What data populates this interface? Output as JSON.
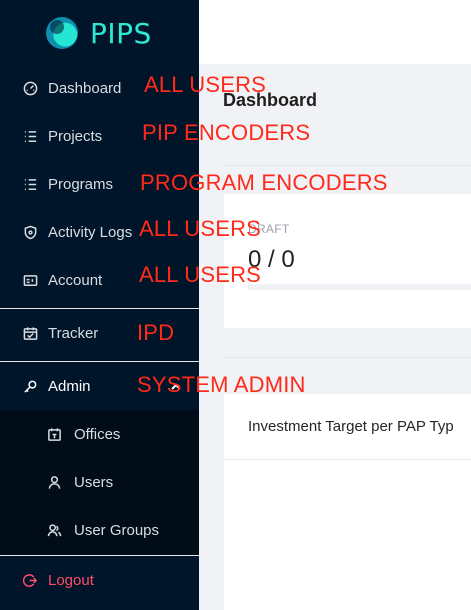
{
  "brand": {
    "name": "PIPS"
  },
  "sidebar": {
    "items": [
      {
        "label": "Dashboard",
        "icon": "dashboard-icon"
      },
      {
        "label": "Projects",
        "icon": "list-icon"
      },
      {
        "label": "Programs",
        "icon": "list-icon"
      },
      {
        "label": "Activity Logs",
        "icon": "shield-icon"
      },
      {
        "label": "Account",
        "icon": "id-card-icon"
      },
      {
        "label": "Tracker",
        "icon": "calendar-icon"
      },
      {
        "label": "Admin",
        "icon": "key-icon",
        "expanded": true
      },
      {
        "label": "Offices",
        "icon": "office-icon"
      },
      {
        "label": "Users",
        "icon": "user-icon"
      },
      {
        "label": "User Groups",
        "icon": "users-icon"
      },
      {
        "label": "Logout",
        "icon": "logout-icon"
      }
    ]
  },
  "main": {
    "title": "Dashboard",
    "stat": {
      "label": "DRAFT",
      "value": "0 / 0"
    },
    "section_title": "Investment Target per PAP Typ"
  },
  "annotations": [
    "ALL USERS",
    "PIP ENCODERS",
    "PROGRAM ENCODERS",
    "ALL USERS",
    "ALL USERS",
    "IPD",
    "SYSTEM ADMIN"
  ],
  "colors": {
    "sidebar_bg": "#001529",
    "submenu_bg": "#000c17",
    "brand": "#2ee9d5",
    "logout": "#ff4d6a",
    "annotation": "#ff2a1a"
  }
}
